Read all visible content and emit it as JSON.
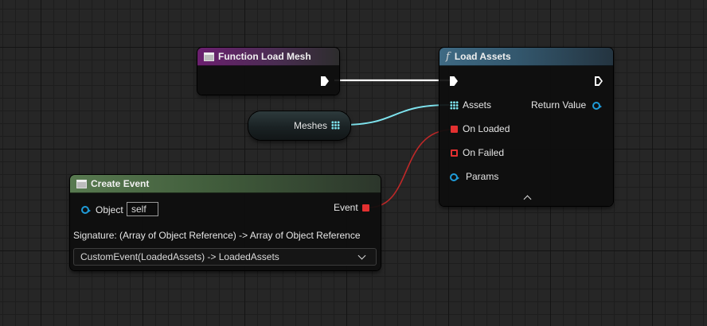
{
  "graph": {
    "function_node": {
      "title": "Function Load Mesh"
    },
    "variable_node": {
      "label": "Meshes"
    },
    "load_assets_node": {
      "title": "Load Assets",
      "func_symbol": "f",
      "pins": {
        "assets": "Assets",
        "return_value": "Return Value",
        "on_loaded": "On Loaded",
        "on_failed": "On Failed",
        "params": "Params"
      }
    },
    "create_event_node": {
      "title": "Create Event",
      "object_label": "Object",
      "object_value": "self",
      "event_label": "Event",
      "signature": "Signature: (Array of Object Reference) -> Array of Object Reference",
      "selected_function": "CustomEvent(LoadedAssets) -> LoadedAssets"
    },
    "colors": {
      "exec_wire": "#ffffff",
      "array_wire": "#7ee3ee",
      "delegate_wire": "#c02828",
      "object_pin": "#1f9bd8",
      "delegate_pin": "#e33030"
    }
  }
}
